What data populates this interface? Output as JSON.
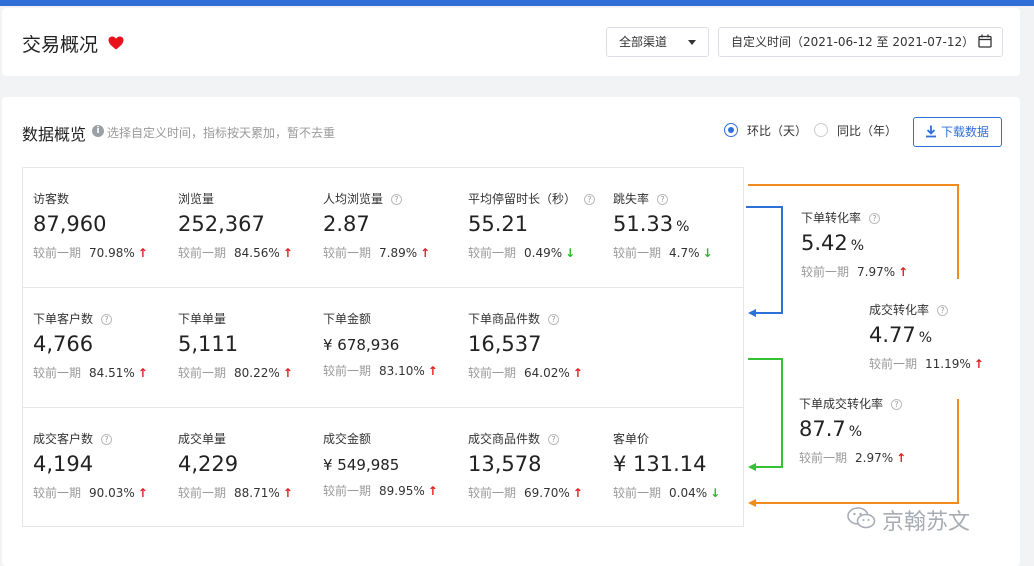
{
  "header": {
    "title": "交易概况",
    "channel_select": "全部渠道",
    "date_range": "自定义时间（2021-06-12 至 2021-07-12）"
  },
  "overview": {
    "title": "数据概览",
    "hint": "选择自定义时间，指标按天累加，暂不去重",
    "radio_mom": "环比（天）",
    "radio_yoy": "同比（年）",
    "download_label": "下载数据",
    "compare_label": "较前一期"
  },
  "metrics": [
    {
      "label": "访客数",
      "value": "87,960",
      "unit": "",
      "pct": "70.98%",
      "dir": "up",
      "help": false
    },
    {
      "label": "浏览量",
      "value": "252,367",
      "unit": "",
      "pct": "84.56%",
      "dir": "up",
      "help": false
    },
    {
      "label": "人均浏览量",
      "value": "2.87",
      "unit": "",
      "pct": "7.89%",
      "dir": "up",
      "help": true
    },
    {
      "label": "平均停留时长（秒）",
      "value": "55.21",
      "unit": "",
      "pct": "0.49%",
      "dir": "down",
      "help": true
    },
    {
      "label": "跳失率",
      "value": "51.33",
      "unit": "%",
      "pct": "4.7%",
      "dir": "down",
      "help": true
    },
    {
      "label": "下单客户数",
      "value": "4,766",
      "unit": "",
      "pct": "84.51%",
      "dir": "up",
      "help": true
    },
    {
      "label": "下单单量",
      "value": "5,111",
      "unit": "",
      "pct": "80.22%",
      "dir": "up",
      "help": false
    },
    {
      "label": "下单金额",
      "value": "¥ 678,936",
      "unit": "",
      "pct": "83.10%",
      "dir": "up",
      "help": false
    },
    {
      "label": "下单商品件数",
      "value": "16,537",
      "unit": "",
      "pct": "64.02%",
      "dir": "up",
      "help": true
    },
    {
      "label": "成交客户数",
      "value": "4,194",
      "unit": "",
      "pct": "90.03%",
      "dir": "up",
      "help": true
    },
    {
      "label": "成交单量",
      "value": "4,229",
      "unit": "",
      "pct": "88.71%",
      "dir": "up",
      "help": false
    },
    {
      "label": "成交金额",
      "value": "¥ 549,985",
      "unit": "",
      "pct": "89.95%",
      "dir": "up",
      "help": false
    },
    {
      "label": "成交商品件数",
      "value": "13,578",
      "unit": "",
      "pct": "69.70%",
      "dir": "up",
      "help": true
    },
    {
      "label": "客单价",
      "value": "¥ 131.14",
      "unit": "",
      "pct": "0.04%",
      "dir": "down",
      "help": false
    }
  ],
  "conversions": [
    {
      "label": "下单转化率",
      "value": "5.42",
      "unit": "%",
      "pct": "7.97%",
      "dir": "up"
    },
    {
      "label": "成交转化率",
      "value": "4.77",
      "unit": "%",
      "pct": "11.19%",
      "dir": "up"
    },
    {
      "label": "下单成交转化率",
      "value": "87.7",
      "unit": "%",
      "pct": "2.97%",
      "dir": "up"
    }
  ],
  "watermark": "京翰苏文",
  "colors": {
    "accent": "#2f6fd8",
    "up": "#e02020",
    "down": "#2eb82e",
    "orange": "#f08c1e",
    "green": "#35c135"
  }
}
